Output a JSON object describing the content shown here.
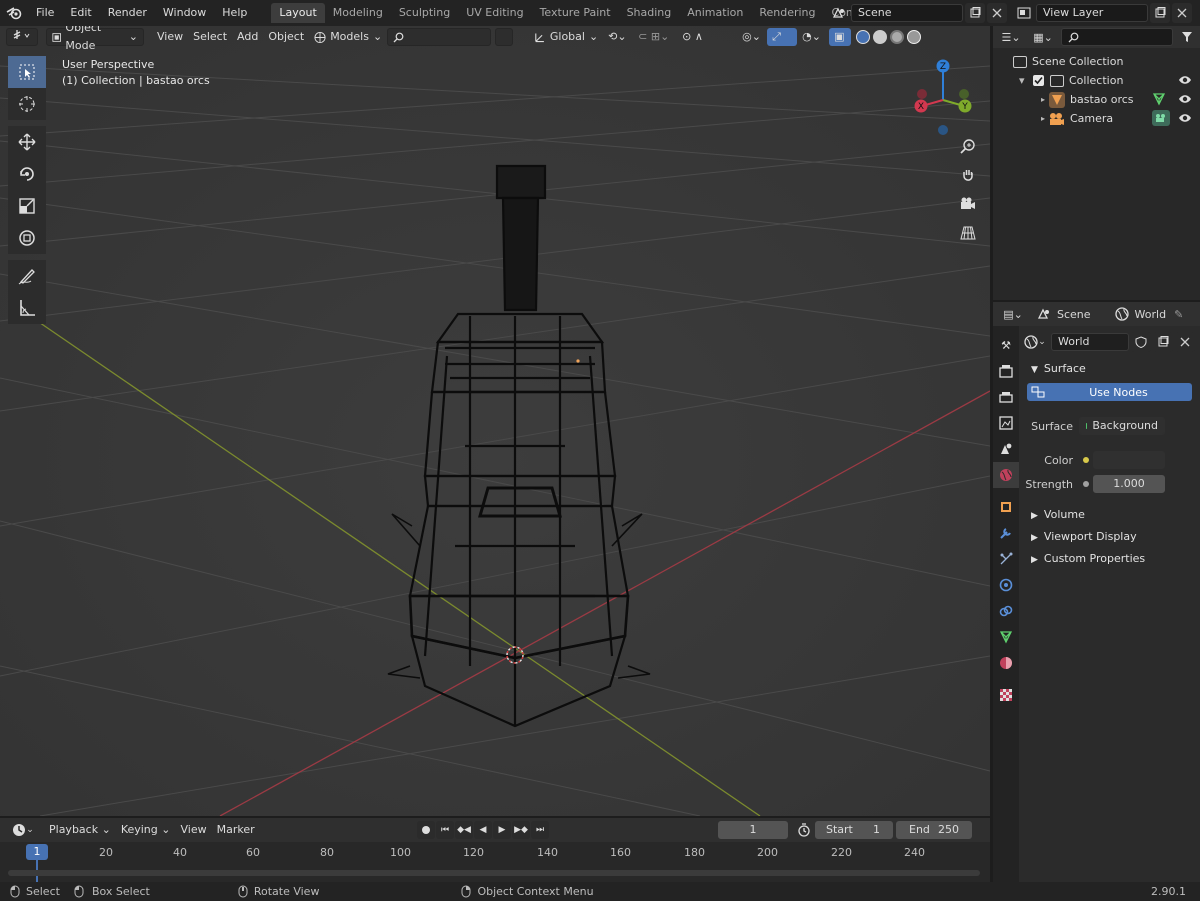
{
  "topbar": {
    "menus": [
      "File",
      "Edit",
      "Render",
      "Window",
      "Help"
    ],
    "workspaces": [
      "Layout",
      "Modeling",
      "Sculpting",
      "UV Editing",
      "Texture Paint",
      "Shading",
      "Animation",
      "Rendering",
      "Compositing"
    ],
    "active_workspace": "Layout",
    "scene_name": "Scene",
    "view_layer": "View Layer"
  },
  "viewport": {
    "mode": "Object Mode",
    "menus": [
      "View",
      "Select",
      "Add",
      "Object"
    ],
    "models_dropdown": "Models",
    "search_placeholder": "",
    "orientation": "Global",
    "info_line1": "User Perspective",
    "info_line2": "(1) Collection | bastao orcs",
    "gizmo_axes": {
      "x": "X",
      "y": "Y",
      "z": "Z"
    }
  },
  "outliner": {
    "search_placeholder": "",
    "items": [
      {
        "label": "Scene Collection"
      },
      {
        "label": "Collection"
      },
      {
        "label": "bastao orcs"
      },
      {
        "label": "Camera"
      }
    ]
  },
  "properties": {
    "scene_label": "Scene",
    "world_label": "World",
    "world_name": "World",
    "surface_panel": "Surface",
    "use_nodes": "Use Nodes",
    "surface_label": "Surface",
    "surface_value": "Background",
    "color_label": "Color",
    "strength_label": "Strength",
    "strength_value": "1.000",
    "collapsed_panels": [
      "Volume",
      "Viewport Display",
      "Custom Properties"
    ]
  },
  "timeline": {
    "menus": [
      "Playback",
      "Keying",
      "View",
      "Marker"
    ],
    "current_frame": "1",
    "start_label": "Start",
    "start_value": "1",
    "end_label": "End",
    "end_value": "250",
    "ruler_current": "1",
    "ruler_ticks": [
      "20",
      "40",
      "60",
      "80",
      "100",
      "120",
      "140",
      "160",
      "180",
      "200",
      "220",
      "240"
    ]
  },
  "statusbar": {
    "select": "Select",
    "box_select": "Box Select",
    "rotate_view": "Rotate View",
    "context_menu": "Object Context Menu",
    "version": "2.90.1"
  },
  "colors": {
    "accent": "#4772b3",
    "x_axis": "#d2384f",
    "y_axis": "#7faa2b",
    "z_axis": "#2f7fd8",
    "viewport_bg": "#393939"
  }
}
